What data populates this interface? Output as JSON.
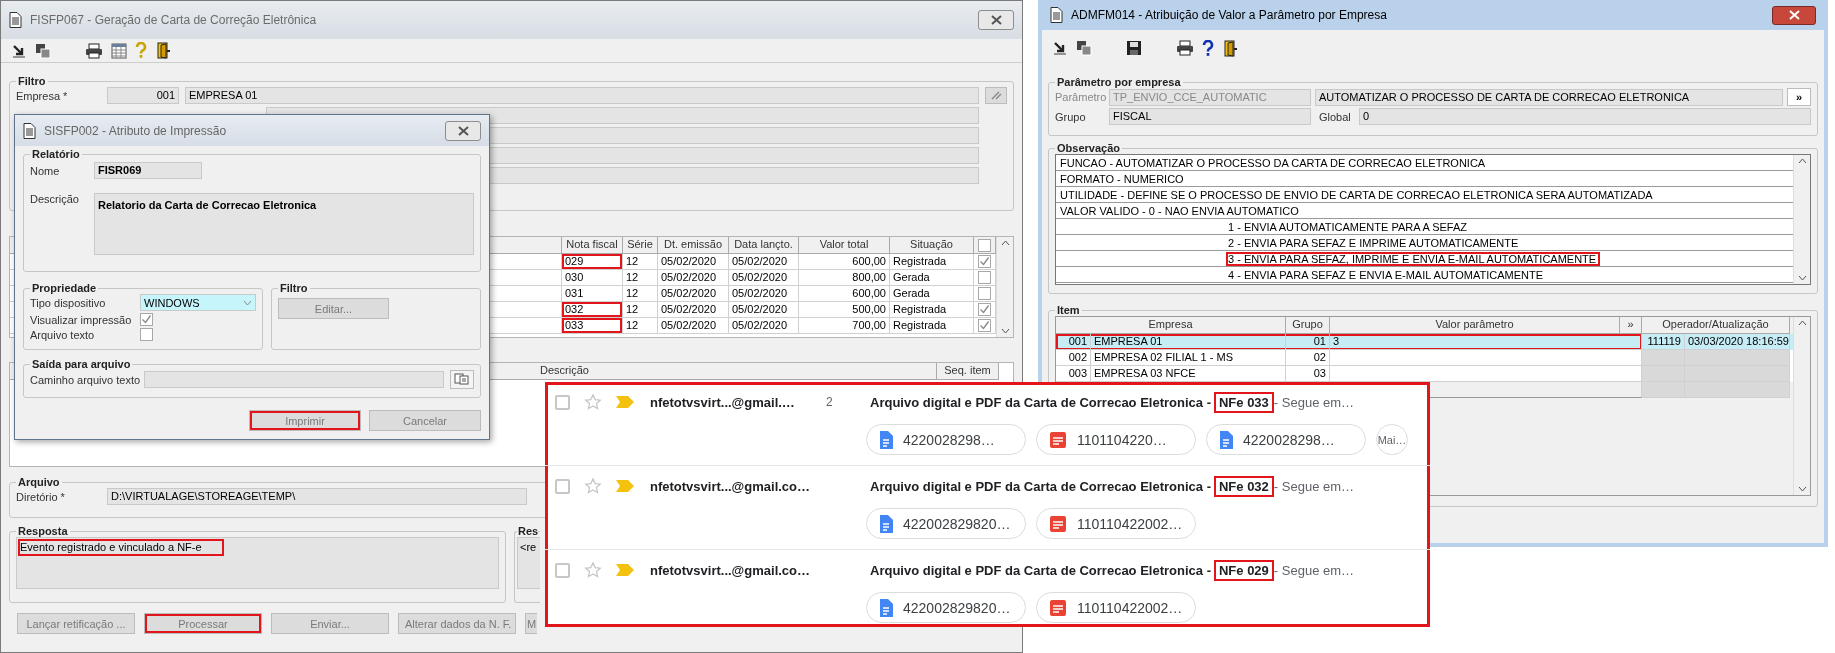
{
  "main_window": {
    "title": "FISFP067 - Geração de Carta de Correção Eletrônica",
    "filter": {
      "title": "Filtro",
      "company_label": "Empresa *",
      "company_code": "001",
      "company_name": "EMPRESA 01"
    },
    "invoices": {
      "columns": [
        "Nota fiscal",
        "Série",
        "Dt. emissão",
        "Data lançto.",
        "Valor total",
        "Situação"
      ],
      "rows": [
        {
          "cells": [
            "029",
            "12",
            "05/02/2020",
            "05/02/2020",
            "600,00",
            "Registrada"
          ],
          "checked": true,
          "highlighted": true
        },
        {
          "cells": [
            "030",
            "12",
            "05/02/2020",
            "05/02/2020",
            "800,00",
            "Gerada"
          ],
          "checked": false,
          "highlighted": false
        },
        {
          "cells": [
            "031",
            "12",
            "05/02/2020",
            "05/02/2020",
            "600,00",
            "Gerada"
          ],
          "checked": false,
          "highlighted": false
        },
        {
          "cells": [
            "032",
            "12",
            "05/02/2020",
            "05/02/2020",
            "500,00",
            "Registrada"
          ],
          "checked": true,
          "highlighted": true
        },
        {
          "cells": [
            "033",
            "12",
            "05/02/2020",
            "05/02/2020",
            "700,00",
            "Registrada"
          ],
          "checked": true,
          "highlighted": true
        }
      ]
    },
    "items": {
      "columns": [
        "Descrição",
        "Seq. item"
      ]
    },
    "archive": {
      "title": "Arquivo",
      "label": "Diretório *",
      "value": "D:\\VIRTUALAGE\\STOREAGE\\TEMP\\"
    },
    "response": {
      "title": "Resposta",
      "text": "Evento registrado e vinculado a NF-e",
      "highlighted": true
    },
    "response_2": {
      "title": "Res",
      "text": "<re"
    },
    "buttons": [
      {
        "label": "Lançar retificação ...",
        "highlighted": false
      },
      {
        "label": "Processar",
        "highlighted": true
      },
      {
        "label": "Enviar...",
        "highlighted": false
      },
      {
        "label": "Alterar dados da N. F.",
        "highlighted": false
      },
      {
        "label": "M",
        "highlighted": false
      }
    ]
  },
  "print_dialog": {
    "title": "SISFP002 - Atributo de Impressão",
    "report": {
      "title": "Relatório",
      "name_label": "Nome",
      "name": "FISR069",
      "description_label": "Descrição",
      "description": "Relatorio da Carta de Correcao Eletronica"
    },
    "properties": {
      "title": "Propriedade",
      "device_label": "Tipo dispositivo",
      "device": "WINDOWS",
      "preview_label": "Visualizar impressão",
      "preview": true,
      "text_file_label": "Arquivo texto",
      "text_file": false
    },
    "filter": {
      "title": "Filtro",
      "button": "Editar..."
    },
    "output": {
      "title": "Saída para arquivo",
      "path_label": "Caminho arquivo texto"
    },
    "buttons": [
      {
        "label": "Imprimir",
        "highlighted": true
      },
      {
        "label": "Cancelar",
        "highlighted": false
      }
    ]
  },
  "param_window": {
    "title": "ADMFM014 - Atribuição de Valor a Parâmetro por Empresa",
    "parameter": {
      "title": "Parâmetro por empresa",
      "param_label": "Parâmetro",
      "param": "TP_ENVIO_CCE_AUTOMATIC",
      "param_desc": "AUTOMATIZAR O PROCESSO DE CARTA DE CORRECAO ELETRONICA",
      "more": "»",
      "group_label": "Grupo",
      "group": "FISCAL",
      "global_label": "Global",
      "global": "0"
    },
    "notes": {
      "title": "Observação",
      "lines": [
        {
          "text": "FUNCAO -  AUTOMATIZAR O PROCESSO DA CARTA DE CORRECAO ELETRONICA",
          "highlighted": false
        },
        {
          "text": "FORMATO - NUMERICO",
          "highlighted": false
        },
        {
          "text": "UTILIDADE - DEFINE SE O PROCESSO DE ENVIO DE CARTA DE CORRECAO ELETRONICA SERA AUTOMATIZADA",
          "highlighted": false
        },
        {
          "text": "VALOR VALIDO - 0 - NAO ENVIA AUTOMATICO",
          "highlighted": false,
          "children": [
            {
              "text": "1 - ENVIA AUTOMATICAMENTE PARA A SEFAZ",
              "highlighted": false
            },
            {
              "text": "2 - ENVIA PARA SEFAZ E IMPRIME AUTOMATICAMENTE",
              "highlighted": false
            },
            {
              "text": "3 - ENVIA PARA SEFAZ, IMPRIME E ENVIA E-MAIL AUTOMATICAMENTE",
              "highlighted": true
            },
            {
              "text": "4 - ENVIA PARA SEFAZ E ENVIA E-MAIL AUTOMATICAMENTE",
              "highlighted": false
            }
          ]
        }
      ]
    },
    "items": {
      "title": "Item",
      "columns": [
        "Empresa",
        "Grupo",
        "Valor parâmetro",
        "»",
        "Operador/Atualização"
      ],
      "rows": [
        {
          "code": "001",
          "company": "EMPRESA 01",
          "group": "01",
          "value": "3",
          "operator": "111119",
          "updated": "03/03/2020 18:16:59",
          "selected": true,
          "highlighted": true
        },
        {
          "code": "002",
          "company": "EMPRESA 02 FILIAL 1 - MS",
          "group": "02",
          "selected": false,
          "highlighted": false
        },
        {
          "code": "003",
          "company": "EMPRESA 03 NFCE",
          "group": "03",
          "selected": false,
          "highlighted": false
        }
      ]
    }
  },
  "mail": {
    "highlighted": true,
    "threads": [
      {
        "checked": false,
        "starred": false,
        "important": true,
        "sender": "nfetotvsvirt...@gmail.…",
        "count": "2",
        "subject": "Arquivo digital e PDF da Carta de Correcao Eletronica -",
        "tag": "NFe 033",
        "tag_highlighted": true,
        "snippet": "- Segue em…",
        "attachments": [
          {
            "kind": "doc",
            "name": "4220028298…"
          },
          {
            "kind": "pdf",
            "name": "1101104220…"
          },
          {
            "kind": "doc",
            "name": "4220028298…"
          }
        ],
        "more": "Mai…"
      },
      {
        "checked": false,
        "starred": false,
        "important": true,
        "sender": "nfetotvsvirt...@gmail.co…",
        "subject": "Arquivo digital e PDF da Carta de Correcao Eletronica -",
        "tag": "NFe 032",
        "tag_highlighted": true,
        "snippet": "- Segue em…",
        "attachments": [
          {
            "kind": "doc",
            "name": "422002829820…"
          },
          {
            "kind": "pdf",
            "name": "110110422002…"
          }
        ]
      },
      {
        "checked": false,
        "starred": false,
        "important": true,
        "sender": "nfetotvsvirt...@gmail.co…",
        "subject": "Arquivo digital e PDF da Carta de Correcao Eletronica -",
        "tag": "NFe 029",
        "tag_highlighted": true,
        "snippet": "- Segue em…",
        "attachments": [
          {
            "kind": "doc",
            "name": "422002829820…"
          },
          {
            "kind": "pdf",
            "name": "110110422002…"
          }
        ]
      }
    ]
  }
}
